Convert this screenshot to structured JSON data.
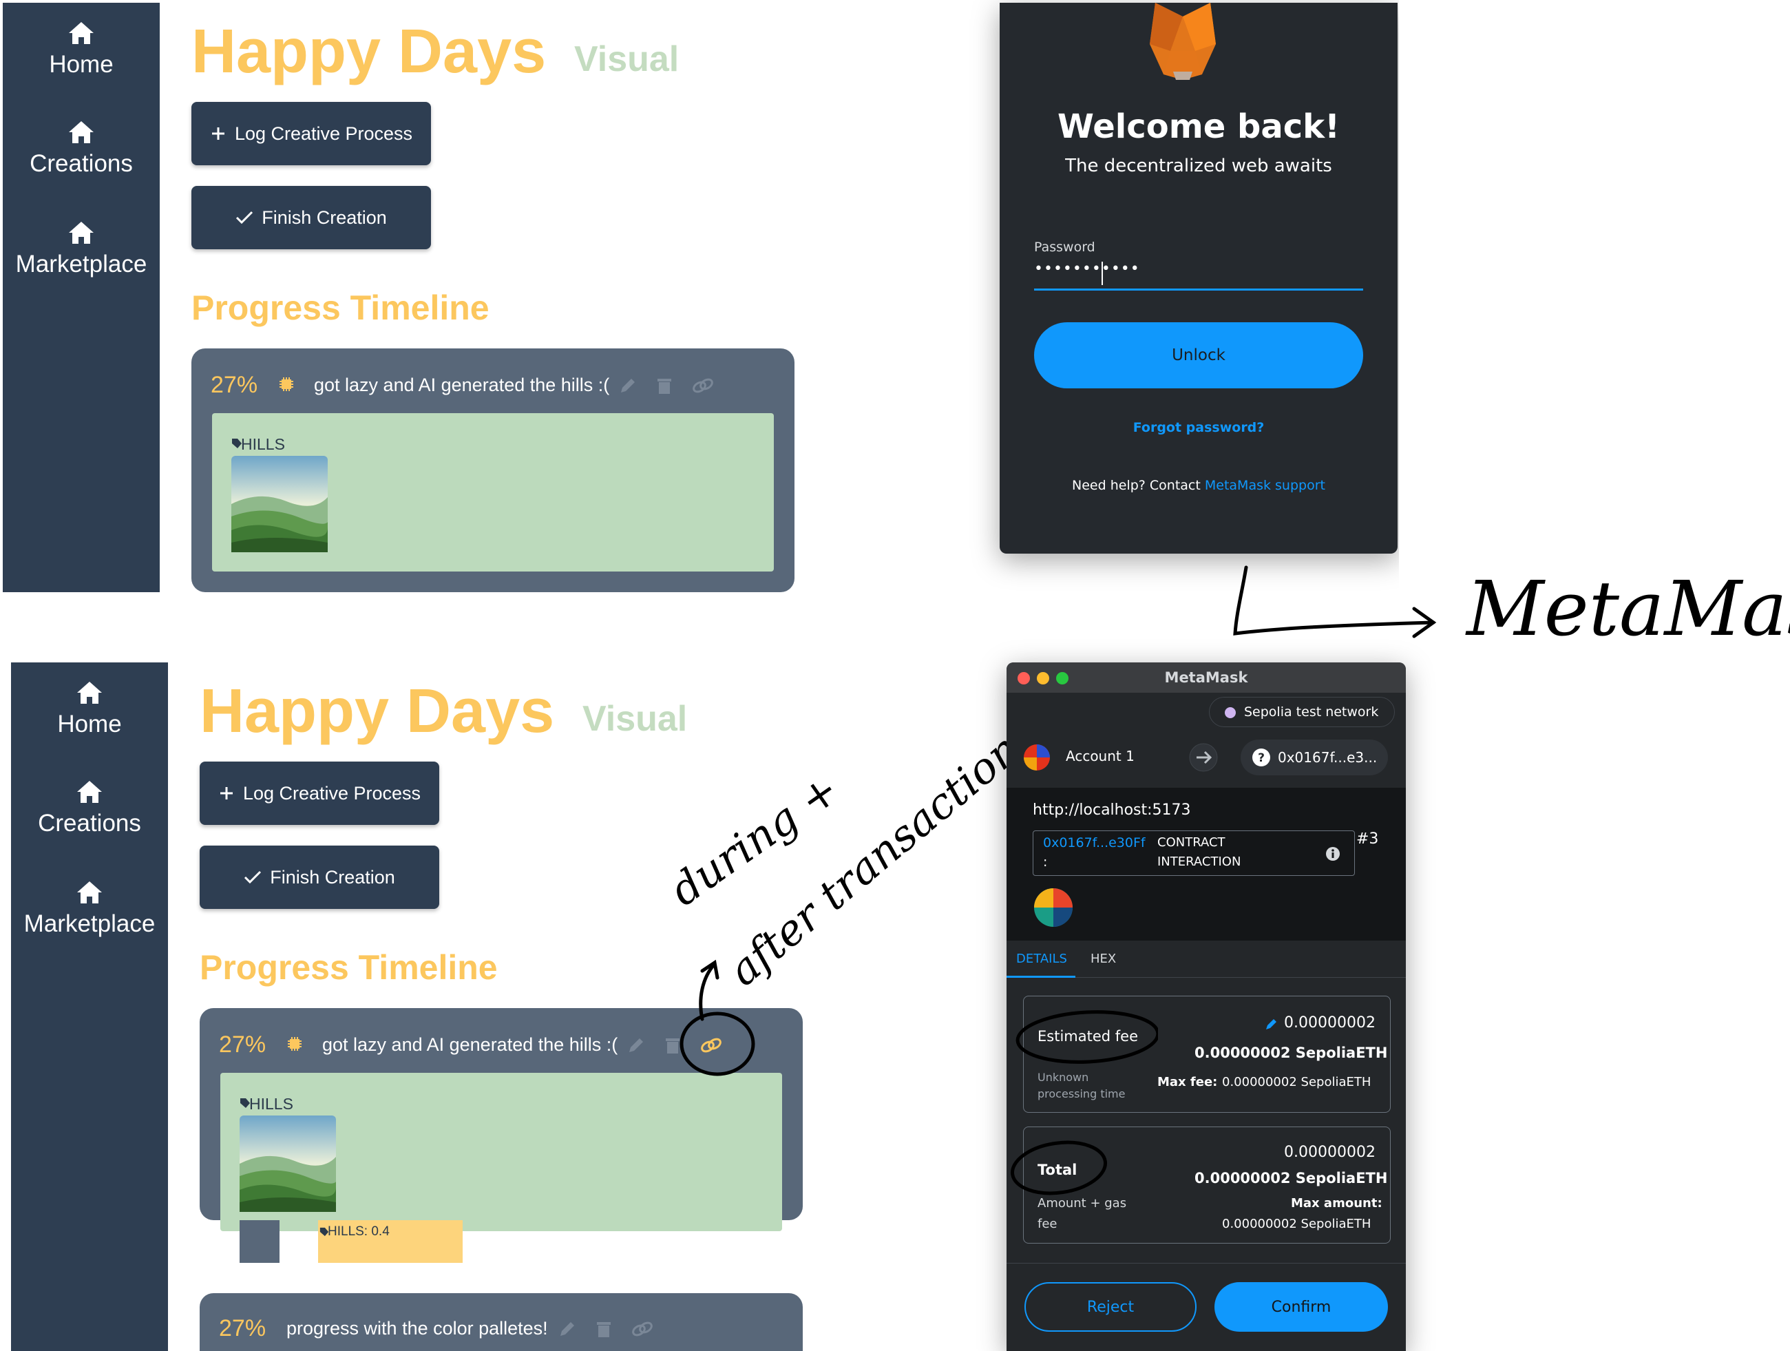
{
  "nav": {
    "home": "Home",
    "creations": "Creations",
    "marketplace": "Marketplace"
  },
  "app": {
    "title": "Happy Days",
    "subtitle": "Visual",
    "log_button": "Log Creative Process",
    "finish_button": "Finish Creation",
    "progress_title": "Progress Timeline"
  },
  "timeline": [
    {
      "percent": "27%",
      "text": "got lazy and AI generated the hills :(",
      "tag": "HILLS"
    },
    {
      "percent": "27%",
      "text": "progress with the color palletes!",
      "tag_bar": "HILLS: 0.4"
    }
  ],
  "metamask_unlock": {
    "heading": "Welcome back!",
    "tagline": "The decentralized web awaits",
    "password_label": "Password",
    "password_value": "•••••••••••",
    "unlock_button": "Unlock",
    "forgot_link": "Forgot password?",
    "help_text": "Need help? Contact ",
    "support_link": "MetaMask support"
  },
  "metamask_confirm": {
    "window_title": "MetaMask",
    "network": "Sepolia test network",
    "account": "Account 1",
    "address_pill": "0x0167f...e3...",
    "origin": "http://localhost:5173",
    "contract_address": "0x0167f...e30Ff",
    "contract_colon": ":",
    "contract_label_1": "CONTRACT",
    "contract_label_2": "INTERACTION",
    "nonce": "#3",
    "tabs": [
      "DETAILS",
      "HEX"
    ],
    "fee_edit_value": "0.00000002",
    "estimated_fee_label": "Estimated fee",
    "estimated_fee_value": "0.00000002 SepoliaETH",
    "unknown_time_1": "Unknown",
    "unknown_time_2": "processing time",
    "max_fee_label": "Max fee:",
    "max_fee_value": "0.00000002 SepoliaETH",
    "total_value_top": "0.00000002",
    "total_label": "Total",
    "total_value": "0.00000002 SepoliaETH",
    "amount_gas_1": "Amount + gas",
    "amount_gas_2": "fee",
    "max_amount_label": "Max amount:",
    "max_amount_value": "0.00000002 SepoliaETH",
    "reject_button": "Reject",
    "confirm_button": "Confirm"
  },
  "annotations": {
    "metamask": "MetaMask",
    "during_after_1": "during +",
    "during_after_2": "after transaction"
  },
  "colors": {
    "sidebar": "#2e3e52",
    "title_yellow": "#fcc75e",
    "subtitle_green": "#c4dcc0",
    "card_gray": "#586779",
    "card_inner_green": "#bcdabc",
    "metamask_blue": "#037dd6",
    "unlock_blue": "#1098fc"
  },
  "icons": {
    "nav": "home-icon",
    "plus": "plus-icon",
    "check": "check-icon",
    "pencil": "pencil-icon",
    "trash": "trash-icon",
    "link": "link-icon",
    "chip": "chip-icon",
    "tag": "tag-icon",
    "fox": "fox-logo",
    "info": "info-icon",
    "arrow": "arrow-right-icon",
    "question": "question-icon"
  }
}
